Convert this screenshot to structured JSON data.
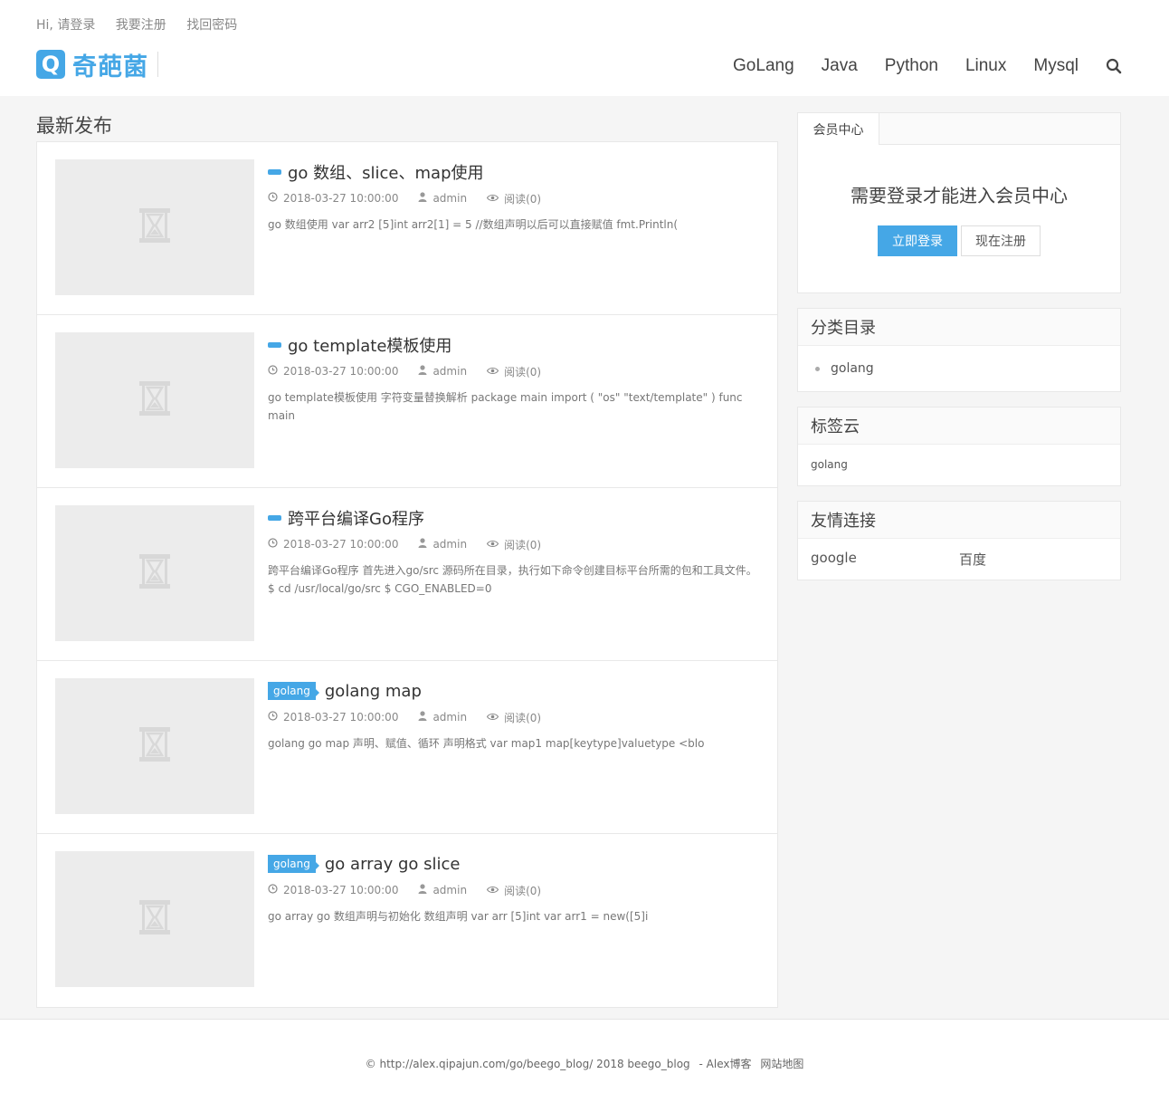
{
  "topbar": {
    "login": "Hi, 请登录",
    "register": "我要注册",
    "recover": "找回密码"
  },
  "logo": {
    "mark": "Q",
    "text": "奇葩菌"
  },
  "nav": [
    "GoLang",
    "Java",
    "Python",
    "Linux",
    "Mysql"
  ],
  "main": {
    "section_title": "最新发布",
    "posts": [
      {
        "badge": "",
        "title": "go 数组、slice、map使用",
        "date": "2018-03-27 10:00:00",
        "author": "admin",
        "reads": "阅读(0)",
        "summary": "go 数组使用 var arr2 [5]int arr2[1] = 5 //数组声明以后可以直接赋值 fmt.Println("
      },
      {
        "badge": "",
        "title": "go template模板使用",
        "date": "2018-03-27 10:00:00",
        "author": "admin",
        "reads": "阅读(0)",
        "summary": "go template模板使用 字符变量替换解析 package main import ( \"os\" \"text/template\" ) func main"
      },
      {
        "badge": "",
        "title": "跨平台编译Go程序",
        "date": "2018-03-27 10:00:00",
        "author": "admin",
        "reads": "阅读(0)",
        "summary": "跨平台编译Go程序 首先进入go/src 源码所在目录，执行如下命令创建目标平台所需的包和工具文件。 $ cd /usr/local/go/src $ CGO_ENABLED=0"
      },
      {
        "badge": "golang",
        "title": "golang map",
        "date": "2018-03-27 10:00:00",
        "author": "admin",
        "reads": "阅读(0)",
        "summary": "golang go map 声明、赋值、循环 声明格式 var map1 map[keytype]valuetype <blo"
      },
      {
        "badge": "golang",
        "title": "go array go slice",
        "date": "2018-03-27 10:00:00",
        "author": "admin",
        "reads": "阅读(0)",
        "summary": "go array go 数组声明与初始化 数组声明 var arr [5]int var arr1 = new([5]i"
      }
    ]
  },
  "sidebar": {
    "member": {
      "tab": "会员中心",
      "message": "需要登录才能进入会员中心",
      "login_btn": "立即登录",
      "register_btn": "现在注册"
    },
    "categories": {
      "title": "分类目录",
      "items": [
        "golang"
      ]
    },
    "tags": {
      "title": "标签云",
      "items": [
        "golang"
      ]
    },
    "links": {
      "title": "友情连接",
      "items": [
        "google",
        "百度"
      ]
    }
  },
  "footer": {
    "copyright": "© http://alex.qipajun.com/go/beego_blog/ 2018 beego_blog",
    "blog": " - Alex博客",
    "sitemap": "网站地图"
  },
  "colors": {
    "accent": "#45a7e6"
  },
  "icons": {
    "search": "search-icon",
    "clock": "clock-icon",
    "user": "user-icon",
    "eye": "eye-icon",
    "placeholder": "hourglass-icon"
  }
}
